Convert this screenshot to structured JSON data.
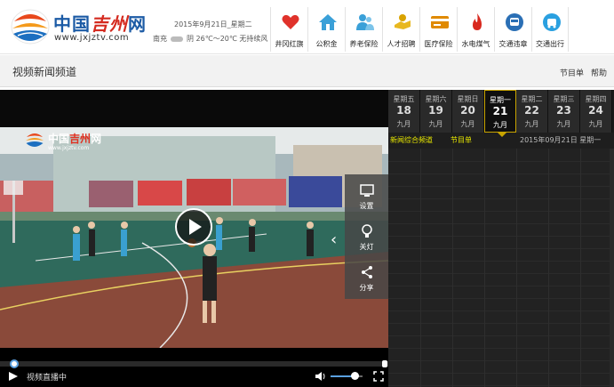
{
  "header": {
    "logo_cn_prefix": "中国",
    "logo_cn_brand": "吉州",
    "logo_cn_suffix": "网",
    "logo_url": "www.jxjztv.com",
    "date": "2015年9月21日_星期二",
    "weather_city": "南充",
    "weather": "阴 26℃～20℃ 无持续风"
  },
  "nav": [
    {
      "label": "井冈红旗",
      "icon": "heart-icon",
      "color": "#e0322b"
    },
    {
      "label": "公积金",
      "icon": "house-icon",
      "color": "#3aa0d8"
    },
    {
      "label": "养老保险",
      "icon": "people-icon",
      "color": "#3aa0d8"
    },
    {
      "label": "人才招聘",
      "icon": "handshake-icon",
      "color": "#d9a300"
    },
    {
      "label": "医疗保险",
      "icon": "card-icon",
      "color": "#e08a00"
    },
    {
      "label": "水电煤气",
      "icon": "flame-icon",
      "color": "#d8281e"
    },
    {
      "label": "交通违章",
      "icon": "bus-icon",
      "color": "#2a6fb5"
    },
    {
      "label": "交通出行",
      "icon": "car-icon",
      "color": "#2aa0e0"
    }
  ],
  "channel": {
    "title": "视频新闻频道",
    "links": [
      "节目单",
      "帮助"
    ]
  },
  "player": {
    "watermark_prefix": "中国",
    "watermark_brand": "吉州",
    "watermark_suffix": "网",
    "watermark_url": "www.jxjztv.com",
    "side_buttons": [
      "设置",
      "关灯",
      "分享"
    ],
    "status": "视频直播中",
    "progress": 0.02,
    "volume": 0.7
  },
  "schedule": {
    "days": [
      {
        "week": "星期五",
        "num": "18",
        "month": "九月",
        "active": false
      },
      {
        "week": "星期六",
        "num": "19",
        "month": "九月",
        "active": false
      },
      {
        "week": "星期日",
        "num": "20",
        "month": "九月",
        "active": false
      },
      {
        "week": "星期一",
        "num": "21",
        "month": "九月",
        "active": true
      },
      {
        "week": "星期二",
        "num": "22",
        "month": "九月",
        "active": false
      },
      {
        "week": "星期三",
        "num": "23",
        "month": "九月",
        "active": false
      },
      {
        "week": "星期四",
        "num": "24",
        "month": "九月",
        "active": false
      }
    ],
    "channel_name": "新闻综合频道",
    "program_label": "节目单",
    "date": "2015年09月21日 星期一"
  }
}
